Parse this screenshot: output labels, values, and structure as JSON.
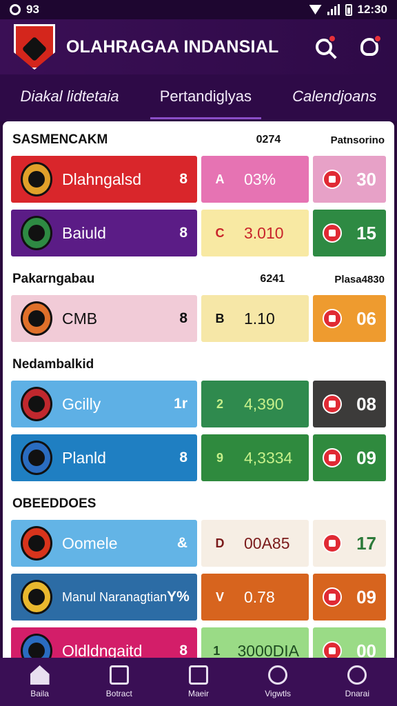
{
  "status": {
    "left": "93",
    "time": "12:30"
  },
  "header": {
    "title": "OLAHRAGAA INDANSIAL"
  },
  "tabs": [
    {
      "label": "Diakal lidtetaia"
    },
    {
      "label": "Pertandiglyas"
    },
    {
      "label": "Calendjoans"
    }
  ],
  "sections": [
    {
      "title": "SASMENCAKM",
      "mid": "0274",
      "right": "Patnsorino",
      "rows": [
        {
          "name": "Dlahngalsd",
          "score": "8",
          "mid_icon": "A",
          "mid_value": "03%",
          "stat": "30",
          "colors": {
            "c1": "#d9262b",
            "c2": "#e673b3",
            "c3": "#e7a1c7",
            "text1": "#ffffff",
            "text2": "#ffffff",
            "text3": "#ffffff",
            "crest": "#e0a02a"
          }
        },
        {
          "name": "Baiuld",
          "score": "8",
          "mid_icon": "C",
          "mid_value": "3.010",
          "stat": "15",
          "colors": {
            "c1": "#5b1c86",
            "c2": "#f8e9a3",
            "c3": "#2e8a43",
            "text1": "#ffffff",
            "text2": "#c8242b",
            "text3": "#ffffff",
            "crest": "#2e8a43"
          }
        }
      ]
    },
    {
      "title": "Pakarngabau",
      "mid": "6241",
      "right": "Plasa4830",
      "rows": [
        {
          "name": "CMB",
          "score": "8",
          "mid_icon": "B",
          "mid_value": "1.10",
          "stat": "06",
          "colors": {
            "c1": "#f1cbd7",
            "c2": "#f6e7a7",
            "c3": "#ee9b2f",
            "text1": "#111111",
            "text2": "#111111",
            "text3": "#ffffff",
            "crest": "#e0702a"
          }
        }
      ]
    },
    {
      "title": "Nedambalkid",
      "mid": "",
      "right": "",
      "rows": [
        {
          "name": "Gcilly",
          "score": "1r",
          "mid_icon": "2",
          "mid_value": "4,390",
          "stat": "08",
          "colors": {
            "c1": "#5eb0e5",
            "c2": "#2f8a4e",
            "c3": "#3c3b3a",
            "text1": "#ffffff",
            "text2": "#c6f08a",
            "text3": "#ffffff",
            "crest": "#c0282e"
          }
        },
        {
          "name": "Planld",
          "score": "8",
          "mid_icon": "9",
          "mid_value": "4,3334",
          "stat": "09",
          "colors": {
            "c1": "#1f7fc2",
            "c2": "#2f8a3e",
            "c3": "#2f8a3e",
            "text1": "#ffffff",
            "text2": "#c6f08a",
            "text3": "#ffffff",
            "crest": "#2a6cc0"
          }
        }
      ]
    },
    {
      "title": "OBEEDDOES",
      "mid": "",
      "right": "",
      "rows": [
        {
          "name": "Oomele",
          "score": "&",
          "mid_icon": "D",
          "mid_value": "00A85",
          "stat": "17",
          "colors": {
            "c1": "#63b4e6",
            "c2": "#f6eee4",
            "c3": "#f6eee4",
            "text1": "#ffffff",
            "text2": "#7a1a1a",
            "text3": "#2d7a3a",
            "crest": "#d8341c"
          }
        },
        {
          "name": "Manul Naranagtian",
          "score": "Y%",
          "mid_icon": "V",
          "mid_value": "0.78",
          "stat": "09",
          "colors": {
            "c1": "#2c6ca5",
            "c2": "#d7641e",
            "c3": "#d7641e",
            "text1": "#ffffff",
            "text2": "#ffffff",
            "text3": "#ffffff",
            "crest": "#e9b82e"
          }
        },
        {
          "name": "Oldldngaitd",
          "score": "8",
          "mid_icon": "1",
          "mid_value": "3000DIA",
          "stat": "00",
          "colors": {
            "c1": "#d31e69",
            "c2": "#9adb86",
            "c3": "#9adb86",
            "text1": "#ffffff",
            "text2": "#1e4c21",
            "text3": "#ffffff",
            "crest": "#2a6cc0"
          }
        }
      ]
    }
  ],
  "nav": [
    {
      "label": "Baila",
      "icon": "home-icon"
    },
    {
      "label": "Botract",
      "icon": "calendar-icon"
    },
    {
      "label": "Maeir",
      "icon": "news-icon"
    },
    {
      "label": "Vigwtls",
      "icon": "video-icon"
    },
    {
      "label": "Dnarai",
      "icon": "profile-icon"
    }
  ]
}
